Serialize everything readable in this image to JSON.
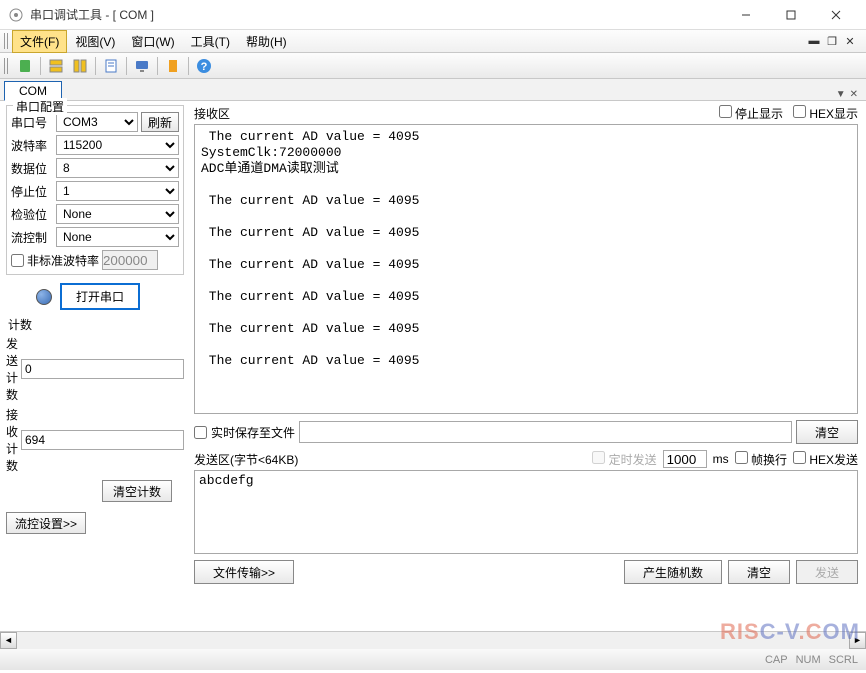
{
  "window": {
    "title": "串口调试工具 - [ COM ]"
  },
  "menu": {
    "file": "文件(F)",
    "view": "视图(V)",
    "window": "窗口(W)",
    "tools": "工具(T)",
    "help": "帮助(H)"
  },
  "doctab": {
    "label": "COM"
  },
  "config": {
    "title": "串口配置",
    "port_label": "串口号",
    "port_value": "COM3",
    "refresh": "刷新",
    "baud_label": "波特率",
    "baud_value": "115200",
    "data_label": "数据位",
    "data_value": "8",
    "stop_label": "停止位",
    "stop_value": "1",
    "parity_label": "检验位",
    "parity_value": "None",
    "flow_label": "流控制",
    "flow_value": "None",
    "nonstd_label": "非标准波特率",
    "nonstd_value": "200000",
    "open_btn": "打开串口"
  },
  "count": {
    "title": "计数",
    "send_label": "发送计数",
    "send_value": "0",
    "recv_label": "接收计数",
    "recv_value": "694",
    "clear_btn": "清空计数"
  },
  "flow_btn": "流控设置>>",
  "recv": {
    "title": "接收区",
    "pause_label": "停止显示",
    "hex_label": "HEX显示",
    "text": " The current AD value = 4095\nSystemClk:72000000\nADC单通道DMA读取测试\n\n The current AD value = 4095\n\n The current AD value = 4095\n\n The current AD value = 4095\n\n The current AD value = 4095\n\n The current AD value = 4095\n\n The current AD value = 4095"
  },
  "save": {
    "label": "实时保存至文件",
    "clear_btn": "清空"
  },
  "send": {
    "title": "发送区(字节<64KB)",
    "timed_label": "定时发送",
    "interval": "1000",
    "ms": "ms",
    "wrap_label": "帧换行",
    "hex_label": "HEX发送",
    "text": "abcdefg",
    "file_btn": "文件传输>>",
    "random_btn": "产生随机数",
    "clear_btn": "清空",
    "send_btn": "发送"
  },
  "status": {
    "cap": "CAP",
    "num": "NUM",
    "scrl": "SCRL"
  },
  "watermark": {
    "a": "RIS",
    "b": "C-V",
    "c": ".C",
    "d": "OM"
  }
}
